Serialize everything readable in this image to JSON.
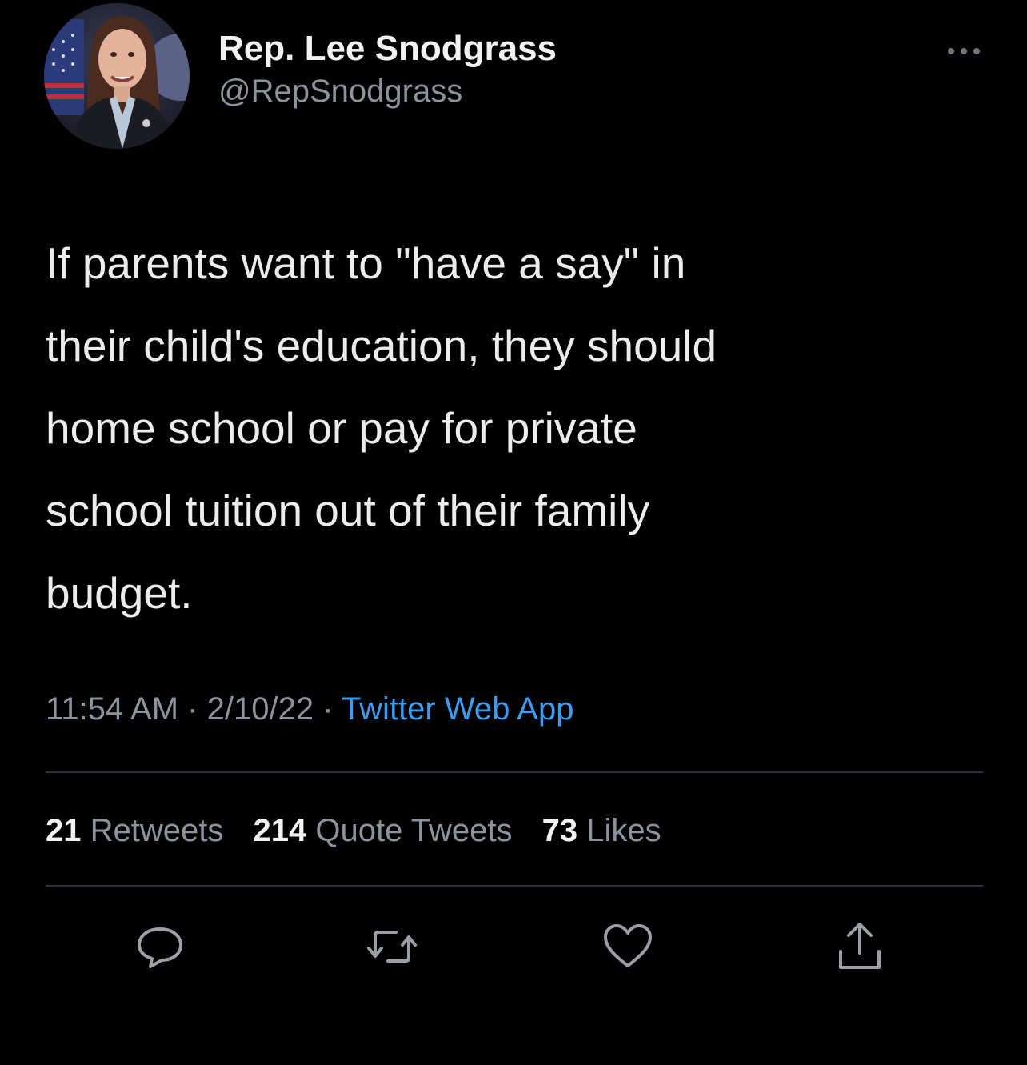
{
  "author": {
    "display_name": "Rep. Lee Snodgrass",
    "handle": "@RepSnodgrass"
  },
  "tweet": {
    "text": "If parents want to \"have a say\" in\ntheir child's education, they should\nhome school or pay for private\nschool tuition out of their family\nbudget.",
    "time": "11:54 AM",
    "date": "2/10/22",
    "separator": "·",
    "source": "Twitter Web App"
  },
  "stats": {
    "retweets_count": "21",
    "retweets_label": "Retweets",
    "quotes_count": "214",
    "quotes_label": "Quote Tweets",
    "likes_count": "73",
    "likes_label": "Likes"
  },
  "icons": {
    "more": "more-icon",
    "reply": "reply-icon",
    "retweet": "retweet-icon",
    "like": "heart-icon",
    "share": "share-icon"
  },
  "colors": {
    "background": "#000000",
    "text": "#e7e9ea",
    "secondary": "#8b949c",
    "link": "#3d9bf0"
  }
}
